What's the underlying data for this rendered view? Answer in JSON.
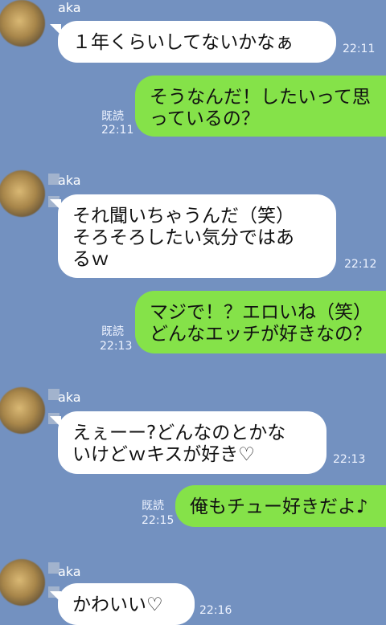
{
  "contact_name": "aka",
  "read_label": "既読",
  "messages": [
    {
      "text": "１年くらいしてないかなぁ",
      "time": "22:11"
    },
    {
      "text": "そうなんだ！したいって思\nっているの？",
      "time": "22:11"
    },
    {
      "text": "それ聞いちゃうんだ（笑）\nそろそろしたい気分ではあ\nるｗ",
      "time": "22:12"
    },
    {
      "text": "マジで！？エロいね（笑）\nどんなエッチが好きなの？",
      "time": "22:13"
    },
    {
      "text": "えぇーー?どんなのとかな\nいけどｗキスが好き♡",
      "time": "22:13"
    },
    {
      "text": "俺もチュー好きだよ♪",
      "time": "22:15"
    },
    {
      "text": "かわいい♡",
      "time": "22:16"
    }
  ]
}
